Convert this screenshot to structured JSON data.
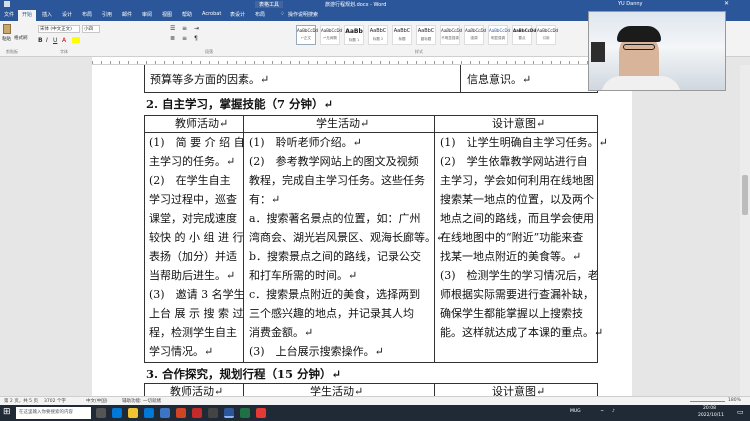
{
  "window": {
    "title": "旅游行程规划.docx - Word",
    "context_tab": "表格工具",
    "user": "YU Danny"
  },
  "ribbon_tabs": [
    "文件",
    "开始",
    "插入",
    "设计",
    "布局",
    "引用",
    "邮件",
    "审阅",
    "视图",
    "帮助",
    "Acrobat",
    "表设计",
    "布局"
  ],
  "tell_me": "操作说明搜索",
  "ribbon": {
    "font_name": "宋体 (中文正文)",
    "font_size": "小四",
    "clipboard_label": "剪贴板",
    "font_label": "字体",
    "paragraph_label": "段落",
    "styles_label": "样式",
    "paste_label": "粘贴",
    "format_painter": "格式刷",
    "styles": [
      {
        "sample": "AaBbCcDd",
        "name": "↵正文"
      },
      {
        "sample": "AaBbCcDd",
        "name": "↵无间隔"
      },
      {
        "sample": "AaBb",
        "name": "标题 1"
      },
      {
        "sample": "AaBbC",
        "name": "标题 2"
      },
      {
        "sample": "AaBbC",
        "name": "标题"
      },
      {
        "sample": "AaBbC",
        "name": "副标题"
      },
      {
        "sample": "AaBbCcDd",
        "name": "不明显强调"
      },
      {
        "sample": "AaBbCcDd",
        "name": "强调"
      },
      {
        "sample": "AaBbCcDd",
        "name": "明显强调"
      },
      {
        "sample": "AaBbCcDd",
        "name": "要点"
      },
      {
        "sample": "AaBbCcDd",
        "name": "引用"
      }
    ]
  },
  "document": {
    "prev_row_left": "预算等多方面的因素。↵",
    "prev_row_right": "信息意识。↵",
    "section2_heading": "2. 自主学习，掌握技能（7 分钟）↵",
    "table2": {
      "headers": [
        "教师活动↵",
        "学生活动↵",
        "设计意图↵"
      ],
      "col1": [
        "(1)　简 要 介 绍 自",
        "主学习的任务。↵",
        "(2)　在学生自主",
        "学习过程中，巡查",
        "课堂，对完成速度",
        "较快 的 小 组 进 行",
        "表扬（加分）并适",
        "当帮助后进生。↵",
        "(3)　邀请 3 名学生",
        "上台 展 示 搜 索 过",
        "程，检测学生自主",
        "学习情况。↵"
      ],
      "col2": [
        "(1)　聆听老师介绍。↵",
        "(2)　参考教学网站上的图文及视频",
        "教程，完成自主学习任务。这些任务",
        "有：↵",
        "a．搜索著名景点的位置，如：广州",
        "湾商会、湖光岩风景区、观海长廊等。↵",
        "b．搜索景点之间的路线，记录公交",
        "和打车所需的时间。↵",
        "c．搜索景点附近的美食，选择两到",
        "三个感兴趣的地点，并记录其人均",
        "消费金额。↵",
        "(3)　上台展示搜索操作。↵"
      ],
      "col3": [
        "(1)　让学生明确自主学习任务。↵",
        "(2)　学生依靠教学网站进行自",
        "主学习，学会如何利用在线地图",
        "搜索某一地点的位置，以及两个",
        "地点之间的路线，而且学会使用",
        "在线地图中的“附近”功能来查",
        "找某一地点附近的美食等。↵",
        "(3)　检测学生的学习情况后，老",
        "师根据实际需要进行查漏补缺，",
        "确保学生都能掌握以上搜索技",
        "能。这样就达成了本课的重点。↵"
      ]
    },
    "section3_heading": "3. 合作探究，规划行程（15 分钟）↵",
    "table3_headers": [
      "教师活动↵",
      "学生活动↵",
      "设计意图↵"
    ]
  },
  "statusbar": {
    "page": "第 2 页，共 5 页",
    "words": "3702 个字",
    "lang": "中文(中国)",
    "accessibility": "辅助功能: 一切就绪",
    "zoom": "180%"
  },
  "taskbar": {
    "search_placeholder": "在这里输入你要搜索的内容",
    "time": "20:08",
    "date": "2022/10/11",
    "lang_indicator": "MUG"
  },
  "colors": {
    "word_blue": "#2b579a",
    "taskbar": "#1f2a36"
  }
}
